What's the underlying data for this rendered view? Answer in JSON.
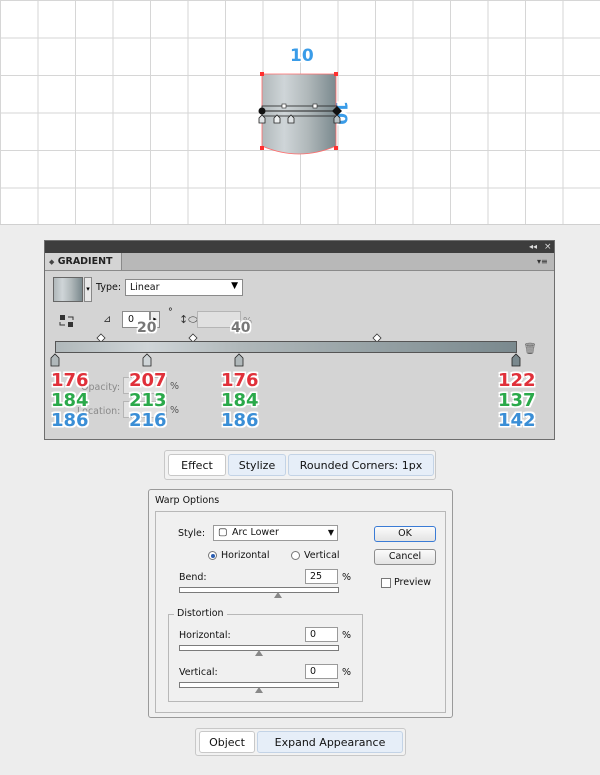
{
  "canvas": {
    "width_label": "10",
    "height_label": "10"
  },
  "gradient_panel": {
    "tab_label": "GRADIENT",
    "type_label": "Type:",
    "type_value": "Linear",
    "angle_value": "0",
    "angle_unit": "°",
    "aspect_unit": "%",
    "opacity_label": "Opacity:",
    "location_label": "Location:",
    "percent": "%",
    "ghost_numbers": [
      "20",
      "40"
    ],
    "stops": [
      {
        "r": "176",
        "g": "184",
        "b": "186"
      },
      {
        "r": "207",
        "g": "213",
        "b": "216"
      },
      {
        "r": "176",
        "g": "184",
        "b": "186"
      },
      {
        "r": "122",
        "g": "137",
        "b": "142"
      }
    ]
  },
  "appearance_row_1": {
    "effect": "Effect",
    "stylize": "Stylize",
    "rounded": "Rounded Corners: 1px"
  },
  "warp_options": {
    "title": "Warp Options",
    "style_label": "Style:",
    "style_value": "Arc Lower",
    "horizontal_label": "Horizontal",
    "vertical_label": "Vertical",
    "bend_label": "Bend:",
    "bend_value": "25",
    "percent": "%",
    "distortion_label": "Distortion",
    "dist_horizontal_label": "Horizontal:",
    "dist_horizontal_value": "0",
    "dist_vertical_label": "Vertical:",
    "dist_vertical_value": "0",
    "ok_label": "OK",
    "cancel_label": "Cancel",
    "preview_label": "Preview"
  },
  "appearance_row_2": {
    "object": "Object",
    "expand": "Expand Appearance"
  },
  "colors": {
    "red": "#e0303a",
    "green": "#2aa94a",
    "blue": "#3a8ed6"
  }
}
